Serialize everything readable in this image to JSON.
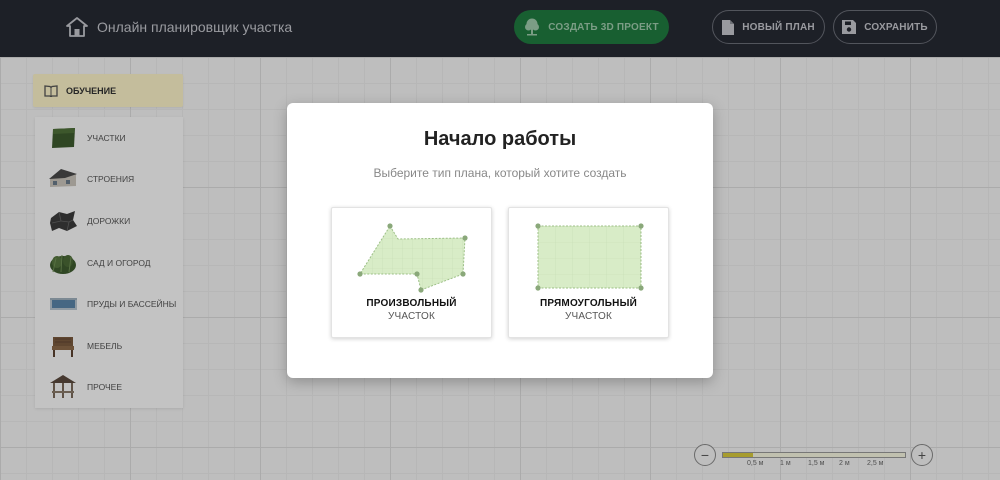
{
  "header": {
    "app_title": "Онлайн планировщик участка",
    "create_3d_label": "СОЗДАТЬ 3D ПРОЕКТ",
    "new_plan_label": "НОВЫЙ ПЛАН",
    "save_label": "СОХРАНИТЬ"
  },
  "sidebar": {
    "tutorial_label": "ОБУЧЕНИЕ",
    "items": [
      {
        "label": "УЧАСТКИ",
        "icon": "grass-tile-icon"
      },
      {
        "label": "СТРОЕНИЯ",
        "icon": "house-icon"
      },
      {
        "label": "ДОРОЖКИ",
        "icon": "paving-icon"
      },
      {
        "label": "САД И ОГОРОД",
        "icon": "bush-icon"
      },
      {
        "label": "ПРУДЫ И БАССЕЙНЫ",
        "icon": "pool-icon"
      },
      {
        "label": "МЕБЕЛЬ",
        "icon": "bench-icon"
      },
      {
        "label": "ПРОЧЕЕ",
        "icon": "gazebo-icon"
      }
    ]
  },
  "scale": {
    "ticks": [
      "0,5 м",
      "1 м",
      "1,5 м",
      "2 м",
      "2,5 м"
    ],
    "zoom_out": "−",
    "zoom_in": "+"
  },
  "modal": {
    "title": "Начало работы",
    "subtitle": "Выберите тип плана, который хотите создать",
    "cards": [
      {
        "title": "ПРОИЗВОЛЬНЫЙ",
        "subtitle": "УЧАСТОК"
      },
      {
        "title": "ПРЯМОУГОЛЬНЫЙ",
        "subtitle": "УЧАСТОК"
      }
    ]
  },
  "colors": {
    "header_bg": "#262933",
    "accent_green": "#1f7a3f",
    "plot_fill": "#d8ecc7",
    "plot_point": "#8aa87a"
  }
}
